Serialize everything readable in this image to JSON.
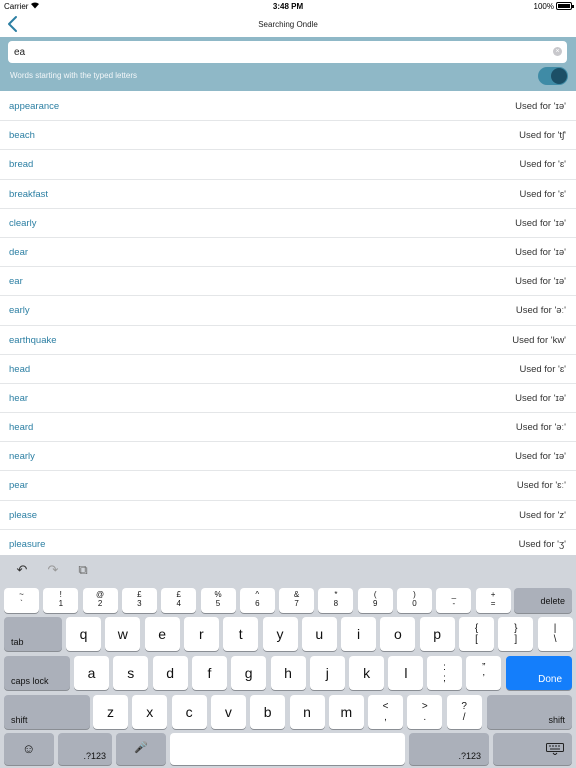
{
  "status": {
    "carrier": "Carrier",
    "time": "3:48 PM",
    "battery": "100%"
  },
  "nav": {
    "title": "Searching Ondle"
  },
  "search": {
    "value": "ea",
    "clear": "×"
  },
  "filter": {
    "label": "Words starting with the typed letters",
    "enabled": true
  },
  "rows": [
    {
      "word": "appearance",
      "used": "Used for 'ɪə'"
    },
    {
      "word": "beach",
      "used": "Used for 'tʃ'"
    },
    {
      "word": "bread",
      "used": "Used for 'ɛ'"
    },
    {
      "word": "breakfast",
      "used": "Used for 'ɛ'"
    },
    {
      "word": "clearly",
      "used": "Used for 'ɪə'"
    },
    {
      "word": "dear",
      "used": "Used for 'ɪə'"
    },
    {
      "word": "ear",
      "used": "Used for 'ɪə'"
    },
    {
      "word": "early",
      "used": "Used for 'əː'"
    },
    {
      "word": "earthquake",
      "used": "Used for 'kw'"
    },
    {
      "word": "head",
      "used": "Used for 'ɛ'"
    },
    {
      "word": "hear",
      "used": "Used for 'ɪə'"
    },
    {
      "word": "heard",
      "used": "Used for 'əː'"
    },
    {
      "word": "nearly",
      "used": "Used for 'ɪə'"
    },
    {
      "word": "pear",
      "used": "Used for 'ɛː'"
    },
    {
      "word": "please",
      "used": "Used for 'z'"
    },
    {
      "word": "pleasure",
      "used": "Used for 'ʒ'"
    }
  ],
  "keyboard": {
    "row1": [
      {
        "top": "~",
        "bottom": "`"
      },
      {
        "top": "!",
        "bottom": "1"
      },
      {
        "top": "@",
        "bottom": "2"
      },
      {
        "top": "£",
        "bottom": "3"
      },
      {
        "top": "£",
        "bottom": "4"
      },
      {
        "top": "%",
        "bottom": "5"
      },
      {
        "top": "^",
        "bottom": "6"
      },
      {
        "top": "&",
        "bottom": "7"
      },
      {
        "top": "*",
        "bottom": "8"
      },
      {
        "top": "(",
        "bottom": "9"
      },
      {
        "top": ")",
        "bottom": "0"
      },
      {
        "top": "_",
        "bottom": "-"
      },
      {
        "top": "+",
        "bottom": "="
      }
    ],
    "delete": "delete",
    "tab": "tab",
    "row2": [
      "q",
      "w",
      "e",
      "r",
      "t",
      "y",
      "u",
      "i",
      "o",
      "p"
    ],
    "row2_extra": [
      {
        "top": "{",
        "bottom": "["
      },
      {
        "top": "}",
        "bottom": "]"
      },
      {
        "top": "|",
        "bottom": "\\"
      }
    ],
    "caps": "caps lock",
    "row3": [
      "a",
      "s",
      "d",
      "f",
      "g",
      "h",
      "j",
      "k",
      "l"
    ],
    "row3_extra": [
      {
        "top": ":",
        "bottom": ";"
      },
      {
        "top": "”",
        "bottom": "’"
      }
    ],
    "done": "Done",
    "shift": "shift",
    "row4": [
      "z",
      "x",
      "c",
      "v",
      "b",
      "n",
      "m"
    ],
    "row4_extra": [
      {
        "top": "<",
        "bottom": ","
      },
      {
        "top": ">",
        "bottom": "."
      },
      {
        "top": "?",
        "bottom": "/"
      }
    ],
    "numbers": ".?123",
    "emoji": "☺",
    "mic": "🎤",
    "undo": "↶",
    "redo": "↷",
    "paste": "⧉"
  }
}
